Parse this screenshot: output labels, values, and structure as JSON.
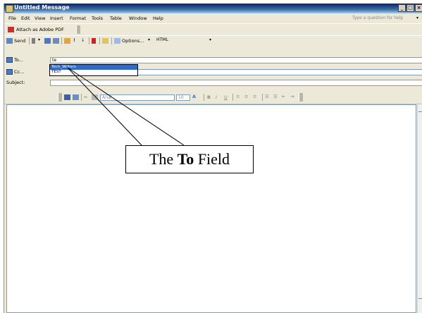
{
  "window": {
    "title": "Untitled Message",
    "controls": [
      "_",
      "□",
      "×"
    ]
  },
  "menubar": {
    "items": [
      "File",
      "Edit",
      "View",
      "Insert",
      "Format",
      "Tools",
      "Table",
      "Window",
      "Help"
    ],
    "help_placeholder": "Type a question for help"
  },
  "toolbar1": {
    "attach_pdf_label": "Attach as Adobe PDF"
  },
  "toolbar2": {
    "send_label": "Send",
    "options_label": "Options...",
    "format_value": "HTML"
  },
  "headers": {
    "to_label": "To...",
    "to_value": "te",
    "cc_label": "Cc...",
    "cc_value": "",
    "subject_label": "Subject:",
    "subject_value": ""
  },
  "autocomplete": {
    "items": [
      "Tech_Writers",
      "TEST"
    ],
    "selected_index": 0
  },
  "formatting": {
    "font_value": "Arial",
    "size_value": "10",
    "bold": "B",
    "italic": "I",
    "underline": "U"
  },
  "callout": {
    "prefix": "The ",
    "bold_word": "To",
    "suffix": " Field"
  }
}
